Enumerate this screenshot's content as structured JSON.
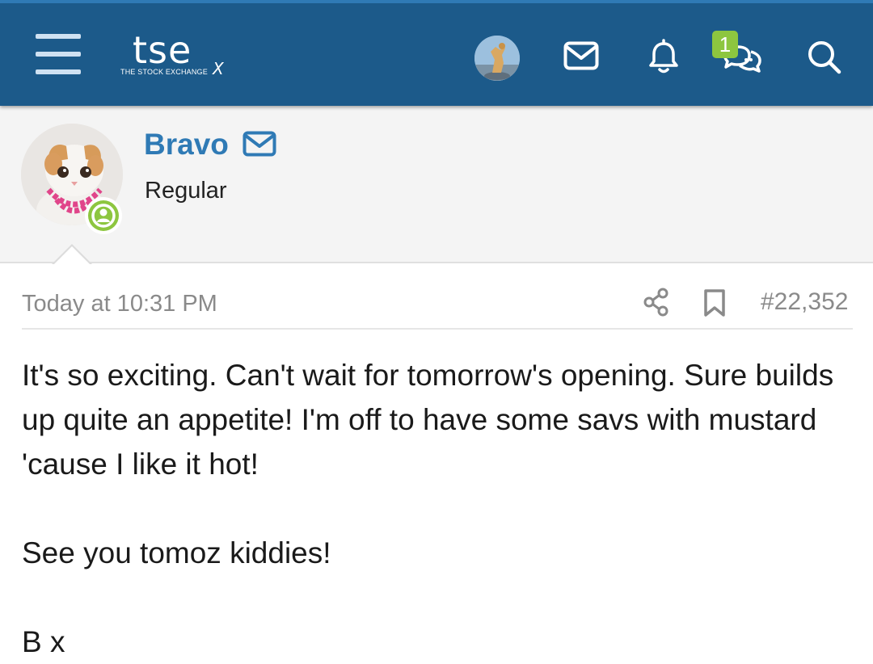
{
  "topbar": {
    "logo_main": "tse",
    "logo_sub": "THE STOCK EXCHANGE",
    "logo_suffix": "X",
    "conversations_badge": "1",
    "icons": [
      "menu-icon",
      "avatar",
      "mail-icon",
      "bell-icon",
      "conversations-icon",
      "search-icon"
    ],
    "background_color": "#1c5a8a"
  },
  "post": {
    "username": "Bravo",
    "user_title": "Regular",
    "date": "Today at 10:31 PM",
    "post_number": "#22,352",
    "username_color": "#2f7ab5",
    "online_color": "#8dc63f",
    "body": {
      "p1": "It's so exciting. Can't wait for tomorrow's opening. Sure builds up quite an appetite! I'm off to have some savs with mustard 'cause I like it hot!",
      "p2": "See you tomoz kiddies!",
      "p3": "B x"
    }
  }
}
